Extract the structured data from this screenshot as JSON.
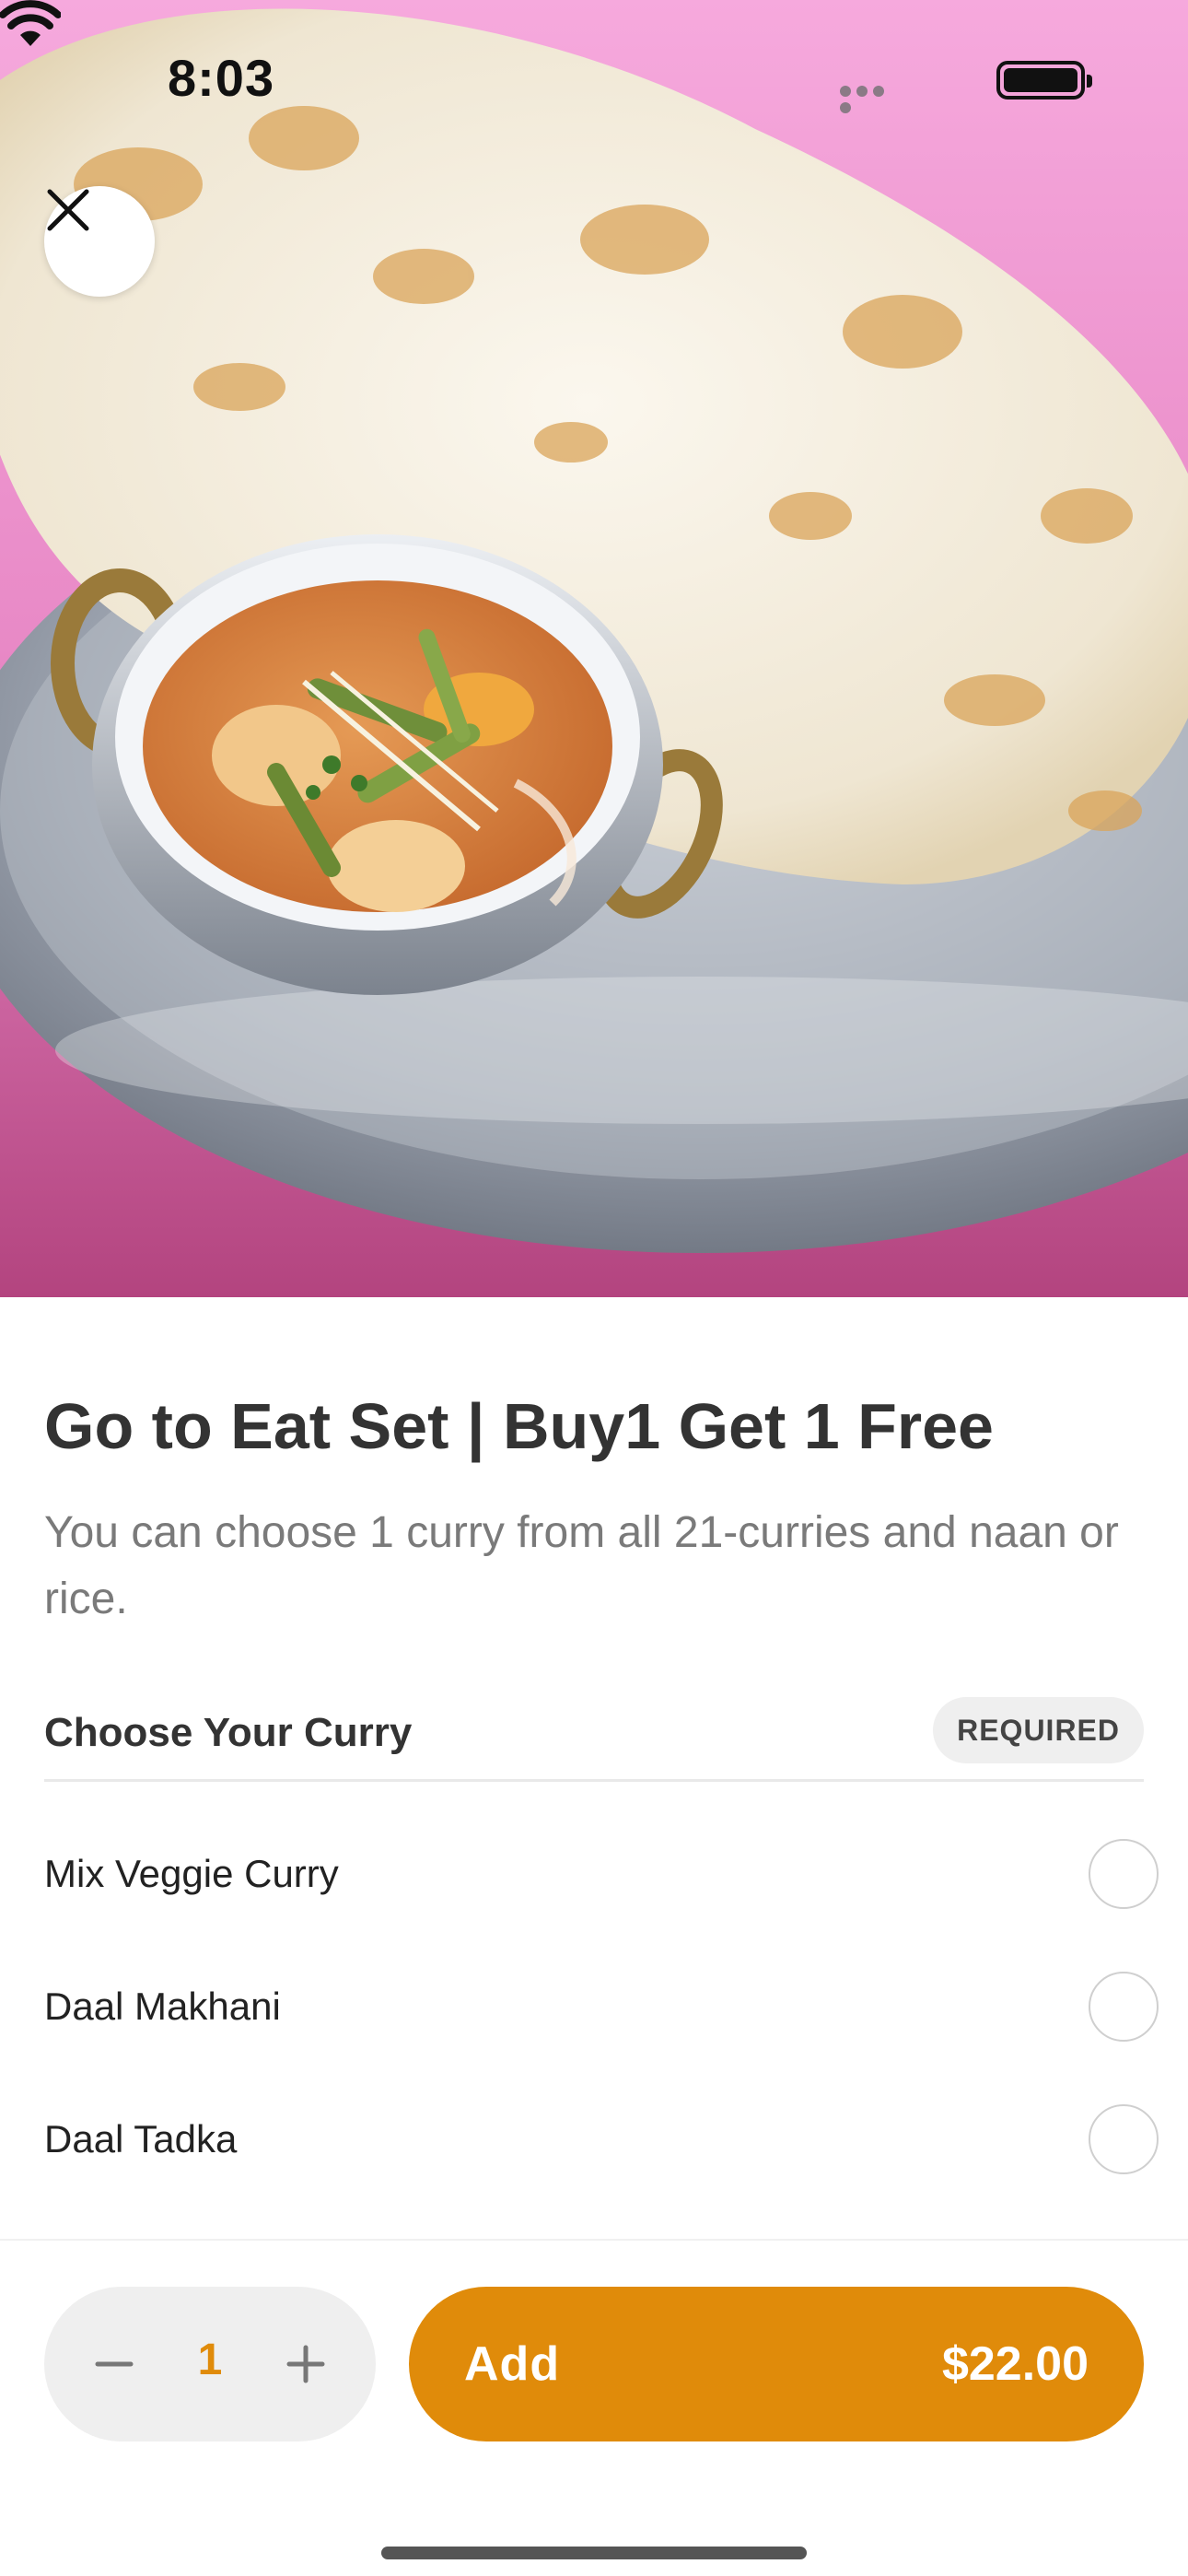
{
  "status_bar": {
    "time": "8:03"
  },
  "hero": {
    "image": "naan-and-curry-photo",
    "close_icon": "close-icon"
  },
  "item": {
    "title": "Go to Eat Set | Buy1 Get 1 Free",
    "description": "You can choose 1 curry from all 21-curries and naan or rice."
  },
  "curry_section": {
    "title": "Choose Your Curry",
    "badge": "REQUIRED",
    "options": [
      {
        "label": "Mix Veggie Curry",
        "selected": false
      },
      {
        "label": "Daal Makhani",
        "selected": false
      },
      {
        "label": "Daal Tadka",
        "selected": false
      }
    ]
  },
  "footer": {
    "quantity": "1",
    "add_label": "Add",
    "price": "$22.00"
  },
  "colors": {
    "accent": "#e08b0a",
    "badge_bg": "#efefef",
    "stepper_bg": "#efefef"
  }
}
